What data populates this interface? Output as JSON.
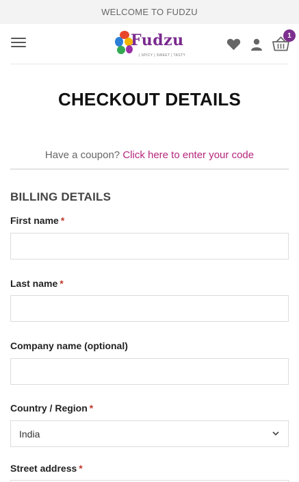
{
  "topbar": {
    "text": "WELCOME TO FUDZU"
  },
  "header": {
    "logo_text": "Fudzu",
    "logo_tagline": "| SPICY | SWEET | TASTY",
    "cart_count": "1"
  },
  "page": {
    "title": "CHECKOUT DETAILS"
  },
  "coupon": {
    "prompt": "Have a coupon?",
    "link": "Click here to enter your code"
  },
  "billing": {
    "title": "BILLING DETAILS",
    "required_mark": "*",
    "fields": {
      "first_name": {
        "label": "First name",
        "value": ""
      },
      "last_name": {
        "label": "Last name",
        "value": ""
      },
      "company": {
        "label": "Company name (optional)",
        "value": ""
      },
      "country": {
        "label": "Country / Region",
        "value": "India"
      },
      "street": {
        "label": "Street address"
      }
    }
  },
  "colors": {
    "accent": "#b5267c",
    "brand": "#7a2a8e",
    "required": "#c0392b"
  },
  "icons": [
    "hamburger-icon",
    "heart-icon",
    "user-icon",
    "basket-icon",
    "chevron-down-icon"
  ]
}
